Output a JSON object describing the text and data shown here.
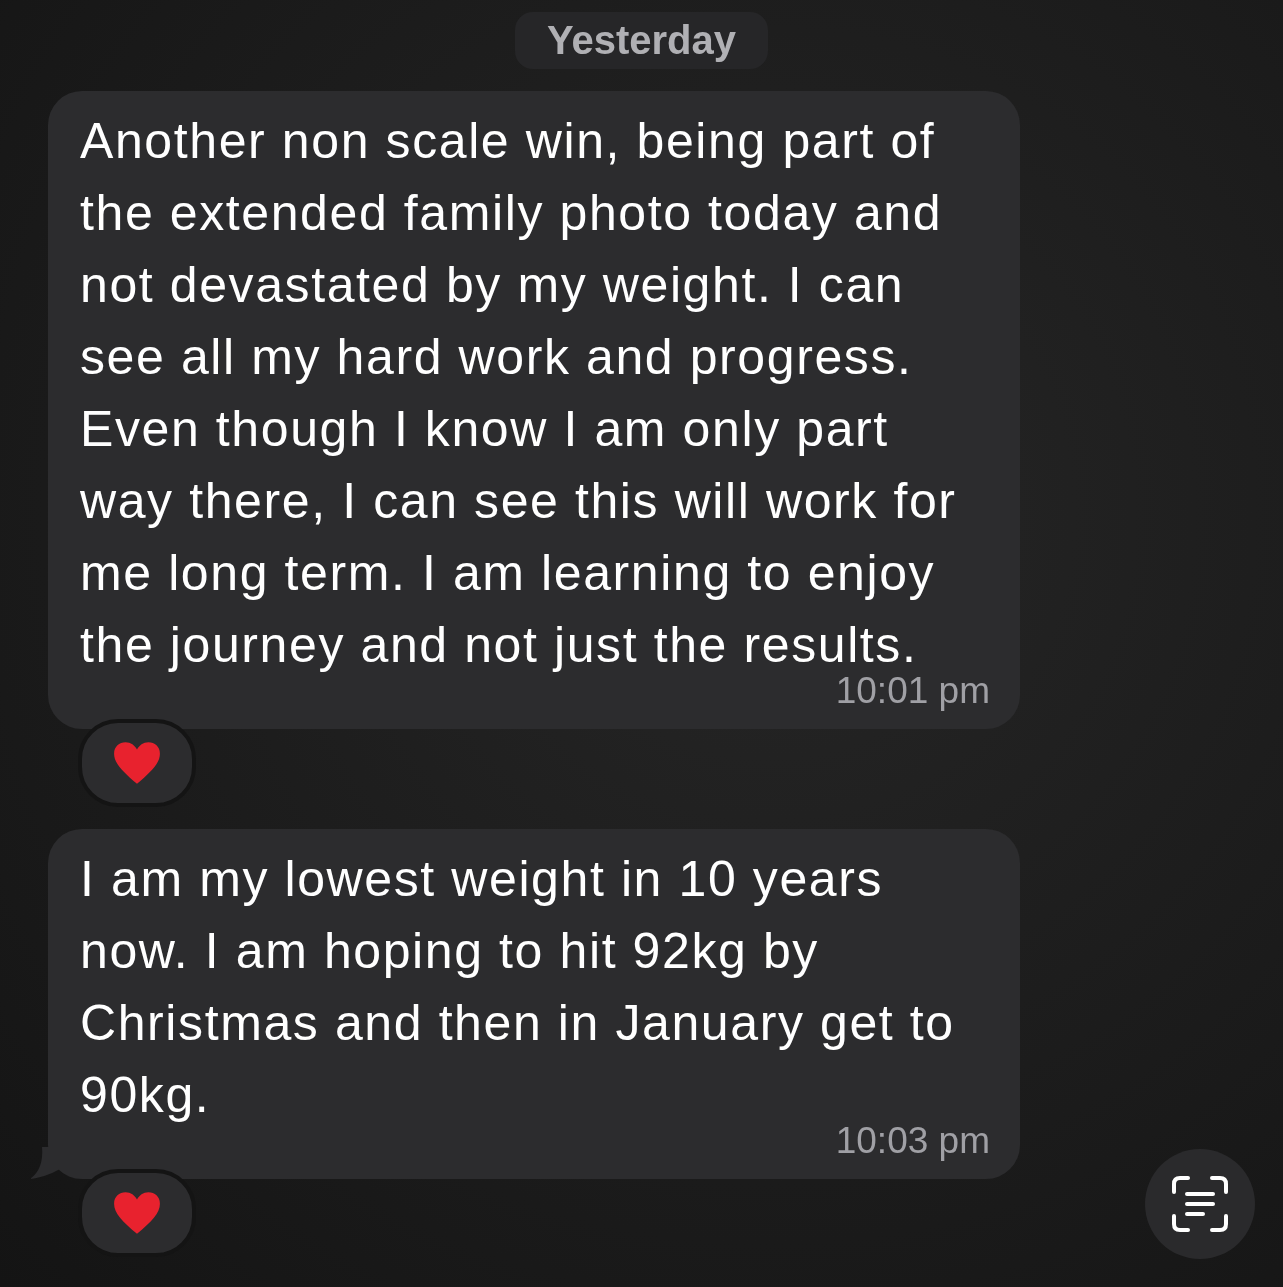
{
  "date_divider": "Yesterday",
  "messages": [
    {
      "text": "Another non scale win, being part of the extended family photo today and not devastated by my weight. I can see all my hard work and progress. Even though I know I am only part way there, I can see this will work for me long term. I am learning to enjoy the journey and not just the results.",
      "time": "10:01 pm",
      "reacted": true,
      "tail": false
    },
    {
      "text": "I am my lowest weight in 10 years now. I am hoping to hit 92kg by Christmas and then in January get to 90kg.",
      "time": "10:03 pm",
      "reacted": true,
      "tail": true
    }
  ]
}
